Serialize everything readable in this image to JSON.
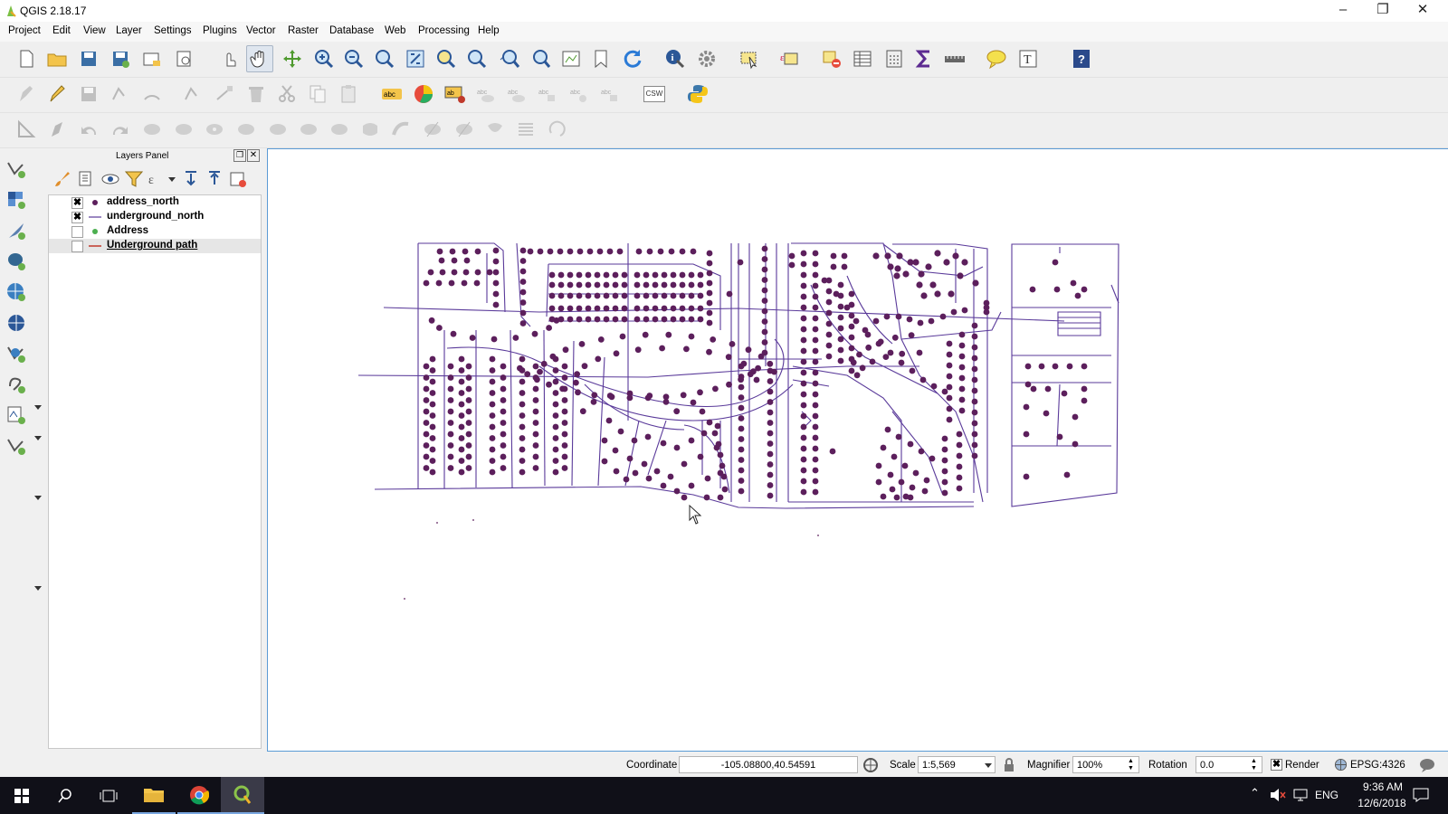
{
  "window": {
    "title": "QGIS 2.18.17"
  },
  "menu": [
    "Project",
    "Edit",
    "View",
    "Layer",
    "Settings",
    "Plugins",
    "Vector",
    "Raster",
    "Database",
    "Web",
    "Processing",
    "Help"
  ],
  "layers_panel": {
    "title": "Layers Panel",
    "layers": [
      {
        "name": "address_north",
        "checked": true,
        "symbol": "point-purple"
      },
      {
        "name": "underground_north",
        "checked": true,
        "symbol": "line-purple"
      },
      {
        "name": "Address",
        "checked": false,
        "symbol": "point-green"
      },
      {
        "name": "Underground path",
        "checked": false,
        "symbol": "line-red",
        "selected": true
      }
    ]
  },
  "toolbar": {
    "csw_label": "CSW"
  },
  "statusbar": {
    "coordinate_label": "Coordinate",
    "coordinate_value": "-105.08800,40.54591",
    "scale_label": "Scale",
    "scale_value": "1:5,569",
    "magnifier_label": "Magnifier",
    "magnifier_value": "100%",
    "rotation_label": "Rotation",
    "rotation_value": "0.0",
    "render_label": "Render",
    "render_checked": true,
    "crs": "EPSG:4326"
  },
  "taskbar": {
    "lang": "ENG",
    "time": "9:36 AM",
    "date": "12/6/2018"
  },
  "colors": {
    "feature": "#5c1f5c",
    "line": "#5a3a9a",
    "canvas_border": "#5b9bd5",
    "taskbar": "#101018"
  }
}
